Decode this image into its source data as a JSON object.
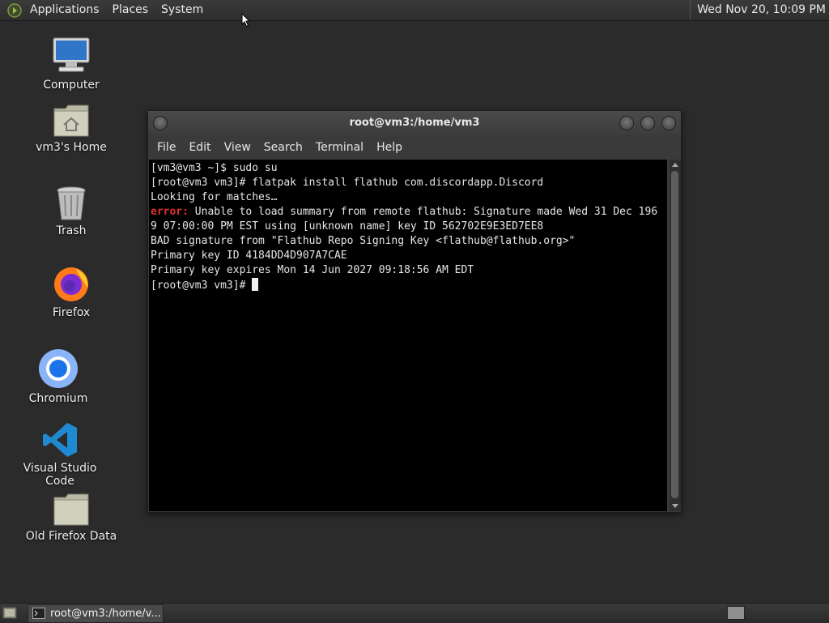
{
  "top_panel": {
    "menus": [
      "Applications",
      "Places",
      "System"
    ],
    "clock": "Wed Nov 20, 10:09 PM"
  },
  "desktop": {
    "icons": [
      {
        "label": "Computer",
        "icon": "computer-icon"
      },
      {
        "label": "vm3's Home",
        "icon": "home-folder-icon"
      },
      {
        "label": "Trash",
        "icon": "trash-icon"
      },
      {
        "label": "Firefox",
        "icon": "firefox-icon"
      },
      {
        "label": "Chromium",
        "icon": "chromium-icon"
      },
      {
        "label": "Visual Studio Code",
        "icon": "vscode-icon"
      },
      {
        "label": "Old Firefox Data",
        "icon": "folder-icon"
      }
    ]
  },
  "terminal": {
    "title": "root@vm3:/home/vm3",
    "menu": [
      "File",
      "Edit",
      "View",
      "Search",
      "Terminal",
      "Help"
    ],
    "lines": [
      "[vm3@vm3 ~]$ sudo su",
      "[root@vm3 vm3]# flatpak install flathub com.discordapp.Discord",
      "Looking for matches…",
      {
        "error_label": "error:",
        "text": " Unable to load summary from remote flathub: Signature made Wed 31 Dec 196"
      },
      "9 07:00:00 PM EST using [unknown name] key ID 562702E9E3ED7EE8",
      "BAD signature from \"Flathub Repo Signing Key <flathub@flathub.org>\"",
      "Primary key ID 4184DD4D907A7CAE",
      "Primary key expires Mon 14 Jun 2027 09:18:56 AM EDT",
      "[root@vm3 vm3]# "
    ]
  },
  "taskbar": {
    "task_label": "root@vm3:/home/v..."
  },
  "colors": {
    "desktop_bg": "#2b2b2b",
    "error_red": "#e0302f",
    "terminal_bg": "#000000"
  }
}
